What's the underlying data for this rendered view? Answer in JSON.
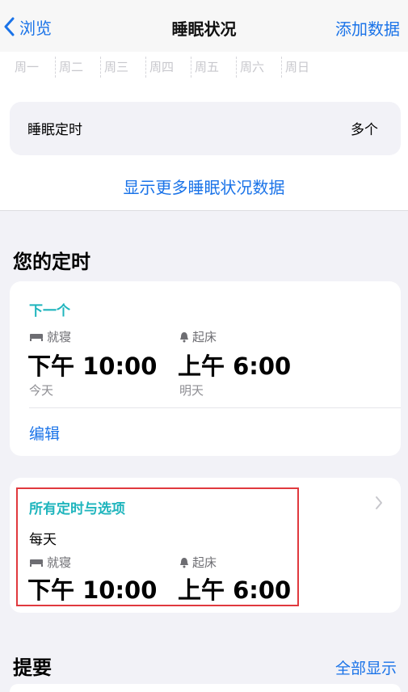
{
  "nav": {
    "back_label": "浏览",
    "title": "睡眠状况",
    "add_label": "添加数据"
  },
  "weekdays": [
    "周一",
    "周二",
    "周三",
    "周四",
    "周五",
    "周六",
    "周日"
  ],
  "sleep_schedule_row": {
    "label": "睡眠定时",
    "value": "多个"
  },
  "show_more_label": "显示更多睡眠状况数据",
  "your_schedule_title": "您的定时",
  "next_card": {
    "heading": "下一个",
    "bedtime_label": "就寝",
    "bedtime": "下午 10:00",
    "bedtime_day": "今天",
    "wake_label": "起床",
    "wake": "上午 6:00",
    "wake_day": "明天",
    "edit_label": "编辑"
  },
  "all_card": {
    "heading": "所有定时与选项",
    "repeat": "每天",
    "bedtime_label": "就寝",
    "bedtime": "下午 10:00",
    "wake_label": "起床",
    "wake": "上午 6:00"
  },
  "summary": {
    "title": "提要",
    "show_all_label": "全部显示"
  },
  "colors": {
    "accent": "#1a73e8",
    "teal": "#1fb5bd",
    "highlight": "#e0393e"
  }
}
